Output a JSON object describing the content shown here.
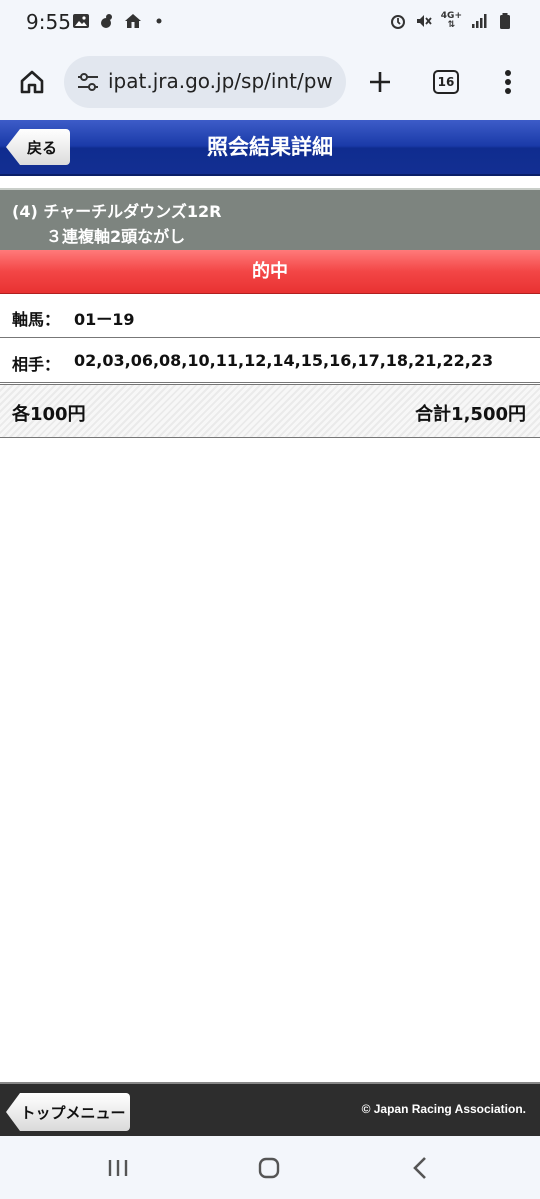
{
  "status_bar": {
    "time": "9:55",
    "network_label": "4G+",
    "left_icons": [
      "image-icon",
      "app-notification-icon",
      "home-notification-icon",
      "dot-icon"
    ],
    "right_icons": [
      "alarm-icon",
      "mute-icon",
      "network-4g-icon",
      "signal-icon",
      "battery-icon"
    ]
  },
  "browser": {
    "url": "ipat.jra.go.jp/sp/int/pw",
    "tab_count": "16"
  },
  "header": {
    "back_label": "戻る",
    "title": "照会結果詳細"
  },
  "race": {
    "line1": "(4) チャーチルダウンズ12R",
    "line2": "３連複軸2頭ながし"
  },
  "result": {
    "status": "的中"
  },
  "bet": {
    "axis_label": "軸馬：",
    "axis_value": "01ー19",
    "partner_label": "相手：",
    "partner_value": "02,03,06,08,10,11,12,14,15,16,17,18,21,22,23",
    "each_amount": "各100円",
    "total_amount": "合計1,500円"
  },
  "footer": {
    "top_menu_label": "トップメニュー",
    "copyright": "© Japan Racing Association."
  },
  "colors": {
    "header_blue": "#1a3aa8",
    "race_info_gray": "#7d847f",
    "hit_red": "#f34646",
    "footer_dark": "#2d2d2d"
  }
}
